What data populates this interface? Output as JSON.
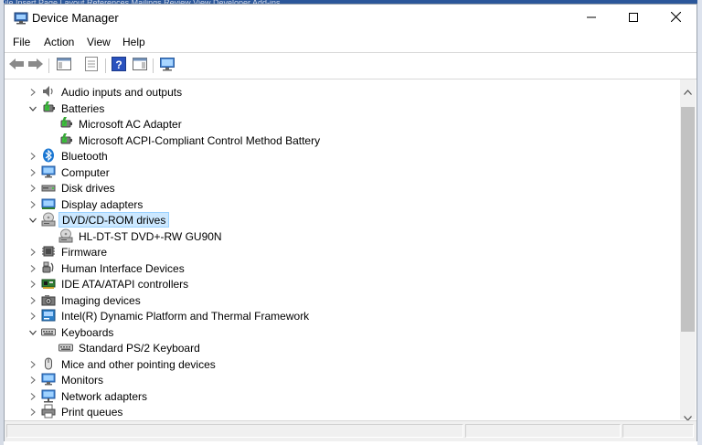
{
  "background": {
    "ribbon_text": "File   Insert   Page Layout   References   Mailings   Review   View   Developer   Add-ins"
  },
  "window": {
    "title": "Device Manager",
    "app_icon": "device-manager-icon",
    "caption_buttons": [
      "minimize-icon",
      "maximize-icon",
      "close-icon"
    ]
  },
  "menu": {
    "items": [
      "File",
      "Action",
      "View",
      "Help"
    ]
  },
  "toolbar": {
    "buttons": [
      "back-arrow-icon",
      "forward-arrow-icon",
      "show-hide-console-tree-icon",
      "properties-icon",
      "help-icon",
      "action-pane-icon",
      "scan-hardware-icon"
    ]
  },
  "tree": {
    "items": [
      {
        "label": "Audio inputs and outputs",
        "icon": "speaker-icon",
        "level": 0,
        "state": "collapsed"
      },
      {
        "label": "Batteries",
        "icon": "battery-icon",
        "level": 0,
        "state": "expanded"
      },
      {
        "label": "Microsoft AC Adapter",
        "icon": "battery-icon",
        "level": 1,
        "state": "leaf"
      },
      {
        "label": "Microsoft ACPI-Compliant Control Method Battery",
        "icon": "battery-icon",
        "level": 1,
        "state": "leaf"
      },
      {
        "label": "Bluetooth",
        "icon": "bluetooth-icon",
        "level": 0,
        "state": "collapsed"
      },
      {
        "label": "Computer",
        "icon": "monitor-icon",
        "level": 0,
        "state": "collapsed"
      },
      {
        "label": "Disk drives",
        "icon": "disk-drive-icon",
        "level": 0,
        "state": "collapsed"
      },
      {
        "label": "Display adapters",
        "icon": "display-adapter-icon",
        "level": 0,
        "state": "collapsed"
      },
      {
        "label": "DVD/CD-ROM drives",
        "icon": "dvd-drive-icon",
        "level": 0,
        "state": "expanded",
        "selected": true
      },
      {
        "label": "HL-DT-ST DVD+-RW GU90N",
        "icon": "dvd-drive-icon",
        "level": 1,
        "state": "leaf"
      },
      {
        "label": "Firmware",
        "icon": "firmware-icon",
        "level": 0,
        "state": "collapsed"
      },
      {
        "label": "Human Interface Devices",
        "icon": "hid-icon",
        "level": 0,
        "state": "collapsed"
      },
      {
        "label": "IDE ATA/ATAPI controllers",
        "icon": "ide-controller-icon",
        "level": 0,
        "state": "collapsed"
      },
      {
        "label": "Imaging devices",
        "icon": "camera-icon",
        "level": 0,
        "state": "collapsed"
      },
      {
        "label": "Intel(R) Dynamic Platform and Thermal Framework",
        "icon": "system-device-icon",
        "level": 0,
        "state": "collapsed"
      },
      {
        "label": "Keyboards",
        "icon": "keyboard-icon",
        "level": 0,
        "state": "expanded"
      },
      {
        "label": "Standard PS/2 Keyboard",
        "icon": "keyboard-icon",
        "level": 1,
        "state": "leaf"
      },
      {
        "label": "Mice and other pointing devices",
        "icon": "mouse-icon",
        "level": 0,
        "state": "collapsed"
      },
      {
        "label": "Monitors",
        "icon": "monitor-icon",
        "level": 0,
        "state": "collapsed"
      },
      {
        "label": "Network adapters",
        "icon": "network-adapter-icon",
        "level": 0,
        "state": "collapsed"
      },
      {
        "label": "Print queues",
        "icon": "printer-icon",
        "level": 0,
        "state": "collapsed"
      }
    ]
  },
  "colors": {
    "selection_fill": "#cce8ff",
    "selection_border": "#99d1ff"
  }
}
